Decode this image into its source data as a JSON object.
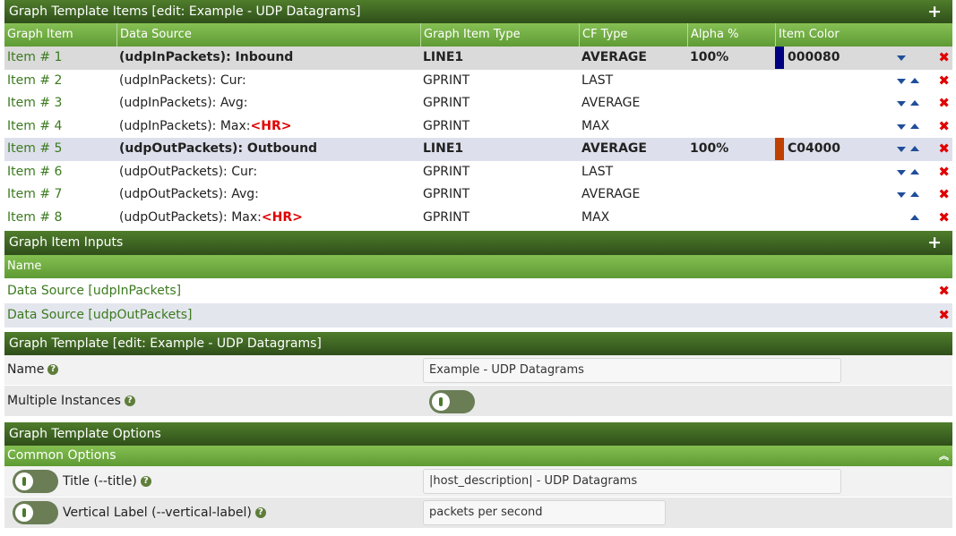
{
  "items_section": {
    "title": "Graph Template Items [edit: Example - UDP Datagrams]",
    "add_icon": "plus-icon",
    "columns": [
      "Graph Item",
      "Data Source",
      "Graph Item Type",
      "CF Type",
      "Alpha %",
      "Item Color"
    ],
    "rows": [
      {
        "item": "Item # 1",
        "source": "(udpInPackets): Inbound",
        "source_hr": "",
        "type": "LINE1",
        "cf": "AVERAGE",
        "alpha": "100%",
        "color_hex": "000080",
        "swatch": "#000080",
        "bold": true,
        "highlight": "sel1",
        "down": true,
        "up": false
      },
      {
        "item": "Item # 2",
        "source": "(udpInPackets): Cur:",
        "source_hr": "",
        "type": "GPRINT",
        "cf": "LAST",
        "alpha": "",
        "color_hex": "",
        "swatch": "",
        "bold": false,
        "highlight": "",
        "down": true,
        "up": true
      },
      {
        "item": "Item # 3",
        "source": "(udpInPackets): Avg:",
        "source_hr": "",
        "type": "GPRINT",
        "cf": "AVERAGE",
        "alpha": "",
        "color_hex": "",
        "swatch": "",
        "bold": false,
        "highlight": "",
        "down": true,
        "up": true
      },
      {
        "item": "Item # 4",
        "source": "(udpInPackets): Max:",
        "source_hr": "<HR>",
        "type": "GPRINT",
        "cf": "MAX",
        "alpha": "",
        "color_hex": "",
        "swatch": "",
        "bold": false,
        "highlight": "",
        "down": true,
        "up": true
      },
      {
        "item": "Item # 5",
        "source": "(udpOutPackets): Outbound",
        "source_hr": "",
        "type": "LINE1",
        "cf": "AVERAGE",
        "alpha": "100%",
        "color_hex": "C04000",
        "swatch": "#C04000",
        "bold": true,
        "highlight": "sel2",
        "down": true,
        "up": true
      },
      {
        "item": "Item # 6",
        "source": "(udpOutPackets): Cur:",
        "source_hr": "",
        "type": "GPRINT",
        "cf": "LAST",
        "alpha": "",
        "color_hex": "",
        "swatch": "",
        "bold": false,
        "highlight": "",
        "down": true,
        "up": true
      },
      {
        "item": "Item # 7",
        "source": "(udpOutPackets): Avg:",
        "source_hr": "",
        "type": "GPRINT",
        "cf": "AVERAGE",
        "alpha": "",
        "color_hex": "",
        "swatch": "",
        "bold": false,
        "highlight": "",
        "down": true,
        "up": true
      },
      {
        "item": "Item # 8",
        "source": "(udpOutPackets): Max:",
        "source_hr": "<HR>",
        "type": "GPRINT",
        "cf": "MAX",
        "alpha": "",
        "color_hex": "",
        "swatch": "",
        "bold": false,
        "highlight": "",
        "down": false,
        "up": true
      }
    ]
  },
  "inputs_section": {
    "title": "Graph Item Inputs",
    "column": "Name",
    "rows": [
      "Data Source [udpInPackets]",
      "Data Source [udpOutPackets]"
    ]
  },
  "template_section": {
    "title": "Graph Template [edit: Example - UDP Datagrams]",
    "name_label": "Name",
    "name_value": "Example - UDP Datagrams",
    "multi_label": "Multiple Instances"
  },
  "options_section": {
    "title": "Graph Template Options",
    "common_title": "Common Options",
    "title_label": "Title (--title)",
    "title_value": "|host_description| - UDP Datagrams",
    "vlabel_label": "Vertical Label (--vertical-label)",
    "vlabel_value": "packets per second"
  },
  "colors": {
    "header": "#2f4f1a",
    "subheader": "#6aa63c",
    "link": "#3b7a1e",
    "delete": "#e00000",
    "arrow": "#1f4e9a"
  }
}
